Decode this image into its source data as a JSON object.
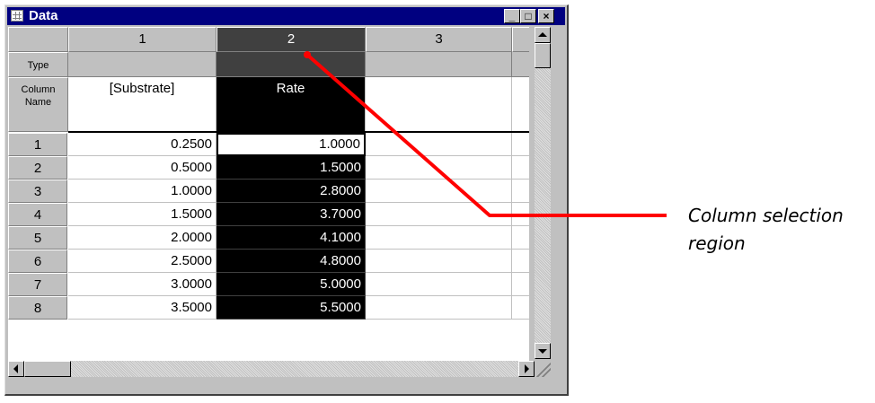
{
  "window": {
    "title": "Data",
    "minimize_glyph": "_",
    "maximize_glyph": "□",
    "close_glyph": "×"
  },
  "columns": [
    {
      "header": "1",
      "type": "",
      "name": "[Substrate]",
      "selected": false
    },
    {
      "header": "2",
      "type": "",
      "name": "Rate",
      "selected": true
    },
    {
      "header": "3",
      "type": "",
      "name": "",
      "selected": false
    }
  ],
  "row_labels": {
    "type": "Type",
    "column_name_line1": "Column",
    "column_name_line2": "Name"
  },
  "rows": [
    {
      "n": "1",
      "substrate": "0.2500",
      "rate": "1.0000"
    },
    {
      "n": "2",
      "substrate": "0.5000",
      "rate": "1.5000"
    },
    {
      "n": "3",
      "substrate": "1.0000",
      "rate": "2.8000"
    },
    {
      "n": "4",
      "substrate": "1.5000",
      "rate": "3.7000"
    },
    {
      "n": "5",
      "substrate": "2.0000",
      "rate": "4.1000"
    },
    {
      "n": "6",
      "substrate": "2.5000",
      "rate": "4.8000"
    },
    {
      "n": "7",
      "substrate": "3.0000",
      "rate": "5.0000"
    },
    {
      "n": "8",
      "substrate": "3.5000",
      "rate": "5.5000"
    }
  ],
  "callout": {
    "line1": "Column selection",
    "line2": "region",
    "color": "#ff0000"
  }
}
